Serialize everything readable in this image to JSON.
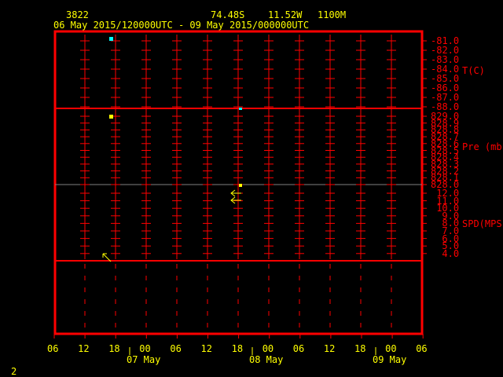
{
  "header": {
    "station_id": "3822",
    "lat": "74.48S",
    "lon": "11.52W",
    "elev": "1100M",
    "time_range": "06 May 2015/120000UTC - 09 May 2015/000000UTC"
  },
  "panels": [
    {
      "label": "T(C)",
      "ticks": [
        "-81.0",
        "-82.0",
        "-83.0",
        "-84.0",
        "-85.0",
        "-86.0",
        "-87.0",
        "-88.0"
      ]
    },
    {
      "label": "Pre (mb)",
      "ticks": [
        "829.0",
        "828.9",
        "828.8",
        "828.7",
        "828.6",
        "828.5",
        "828.4",
        "828.3",
        "828.2",
        "828.1",
        "828.0"
      ]
    },
    {
      "label": "SPD(MPS)",
      "ticks": [
        "12.0",
        "11.0",
        "10.0",
        "9.0",
        "8.0",
        "7.0",
        "6.0",
        "5.0",
        "4.0"
      ]
    }
  ],
  "x_axis": {
    "hours": [
      "06",
      "12",
      "18",
      "00",
      "06",
      "12",
      "18",
      "00",
      "06",
      "12",
      "18",
      "00",
      "06"
    ],
    "dates": [
      "07 May",
      "08 May",
      "09 May"
    ]
  },
  "footer": {
    "page": "2"
  },
  "colors": {
    "frame": "#ff0000",
    "text": "#ffff00",
    "temp_marker": "#00ffff",
    "data_marker": "#ffff00"
  }
}
